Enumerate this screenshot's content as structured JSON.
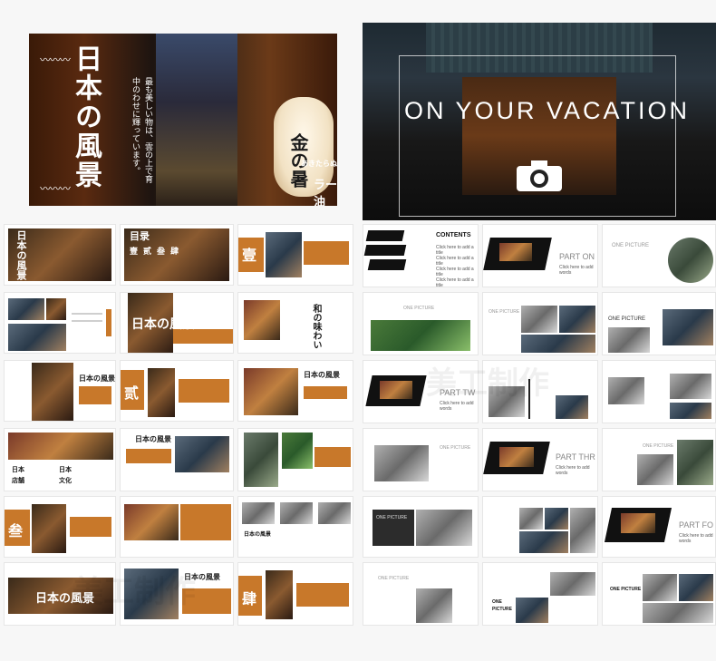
{
  "hero_left": {
    "title": "日本の風景",
    "poem_line1": "最も美しい物は、雲の上で育",
    "poem_line2": "中のわせに輝っています。",
    "lantern": "金の暑",
    "ramen": "ラー油",
    "ramen_small": "あきたらぬ"
  },
  "hero_right": {
    "headline": "ON YOUR VACATION"
  },
  "thumbs_left": {
    "title_jp": "日本の風景",
    "contents_jp": "目录",
    "toc_items": [
      "壹",
      "贰",
      "叁",
      "肆"
    ],
    "num_one": "壹",
    "num_two": "贰",
    "num_three": "叁",
    "num_four": "肆",
    "side_a": "日本",
    "side_b": "店舗",
    "side_c": "日本",
    "side_d": "文化",
    "brush_text": "和の味わい"
  },
  "thumbs_right": {
    "contents_title": "CONTENTS",
    "contents_items": [
      "Click here to add a title",
      "Click here to add a title",
      "Click here to add a title",
      "Click here to add a title"
    ],
    "part_one": "PART ON",
    "part_two": "PART TW",
    "part_three": "PART THR",
    "part_four": "PART FO",
    "one_picture": "ONE PICTURE",
    "click_text": "Click here to add words",
    "cap_one": "ONE",
    "cap_picture": "PICTURE"
  },
  "watermark": "美工制作"
}
